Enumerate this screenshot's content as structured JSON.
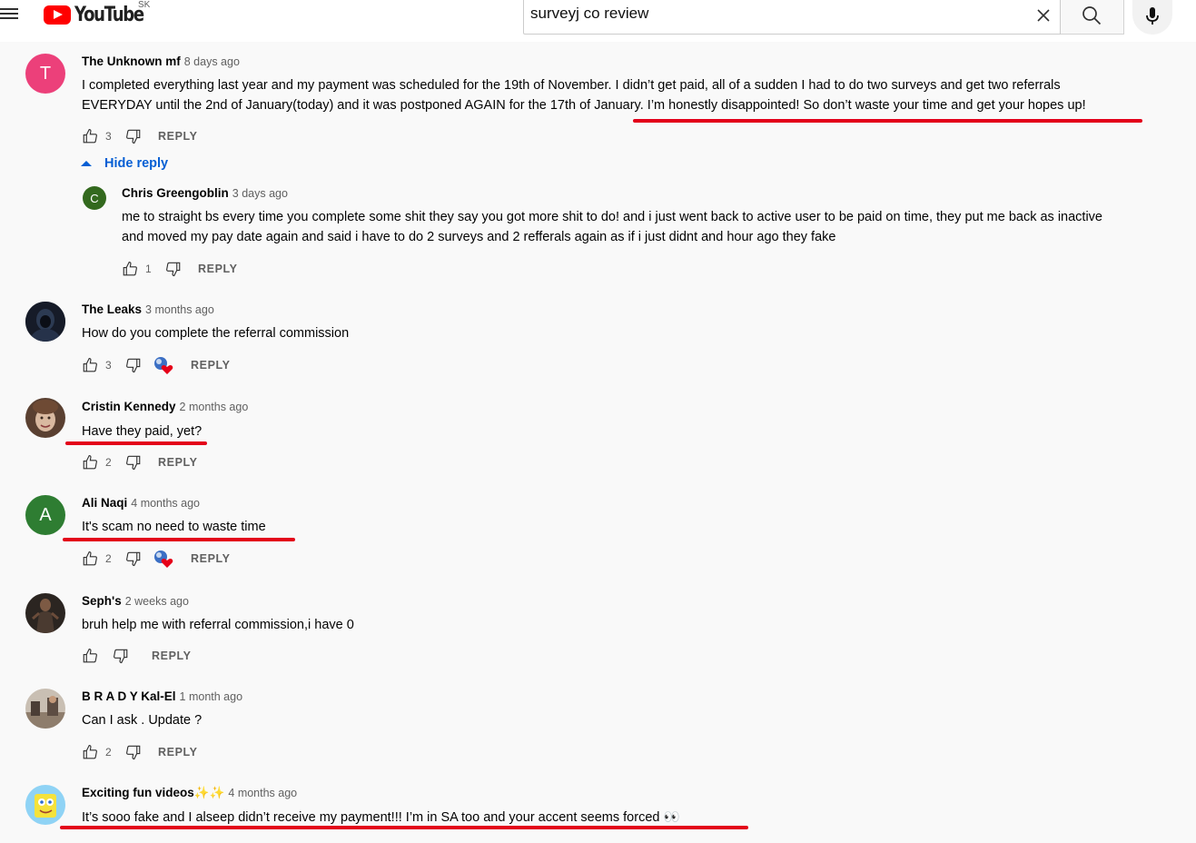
{
  "header": {
    "logo_text": "YouTube",
    "country_code": "SK",
    "search_value": "surveyj co review",
    "icons": [
      "menu-icon",
      "clear-icon",
      "search-icon",
      "mic-icon"
    ]
  },
  "comments": [
    {
      "author": "The Unknown mf",
      "time": "8 days ago",
      "avatar_letter": "T",
      "avatar_color": "#ec407a",
      "text_lines": [
        "I completed everything last year and my payment was scheduled for the 19th of  November. I didn’t get paid, all of a sudden I had to do two surveys and get two referrals",
        "EVERYDAY until the 2nd of January(today) and it was postponed AGAIN for the 17th of January. I’m honestly disappointed! So don’t waste your time and get your hopes up!"
      ],
      "likes": "3",
      "reply": "REPLY",
      "hide_reply": "Hide reply"
    },
    {
      "author": "Chris Greengoblin",
      "time": "3 days ago",
      "avatar_letter": "C",
      "avatar_color": "#33691e",
      "text_lines": [
        "me to straight bs every time you complete some shit they say you got more shit to do! and i just went back to active user to be paid on time, they put me back as inactive",
        "and moved my pay date again and said i have to do 2 surveys and 2 refferals again as if i just didnt and hour ago they fake"
      ],
      "likes": "1",
      "reply": "REPLY"
    },
    {
      "author": "The Leaks",
      "time": "3 months ago",
      "text": "How do you complete the referral commission",
      "likes": "3",
      "reply": "REPLY"
    },
    {
      "author": "Cristin Kennedy",
      "time": "2 months ago",
      "text": "Have they paid, yet?",
      "likes": "2",
      "reply": "REPLY"
    },
    {
      "author": "Ali Naqi",
      "time": "4 months ago",
      "avatar_letter": "A",
      "avatar_color": "#2e7d32",
      "text": "It's scam no need to waste time",
      "likes": "2",
      "reply": "REPLY"
    },
    {
      "author": "Seph's",
      "time": "2 weeks ago",
      "text": "bruh help me with referral commission,i have 0",
      "likes": "",
      "reply": "REPLY"
    },
    {
      "author": "B R A D Y Kal-El",
      "time": "1 month ago",
      "text": "Can I ask . Update ?",
      "likes": "2",
      "reply": "REPLY"
    },
    {
      "author": "Exciting fun videos✨✨",
      "time": "4 months ago",
      "text": "It’s sooo fake and I alseep didn’t receive my payment!!! I’m in SA too and your accent seems forced 👀",
      "likes": "",
      "reply": "REPLY"
    }
  ],
  "colors": {
    "highlight_underline": "#e3001a",
    "link_blue": "#065fd4",
    "youtube_red": "#ff0000"
  }
}
